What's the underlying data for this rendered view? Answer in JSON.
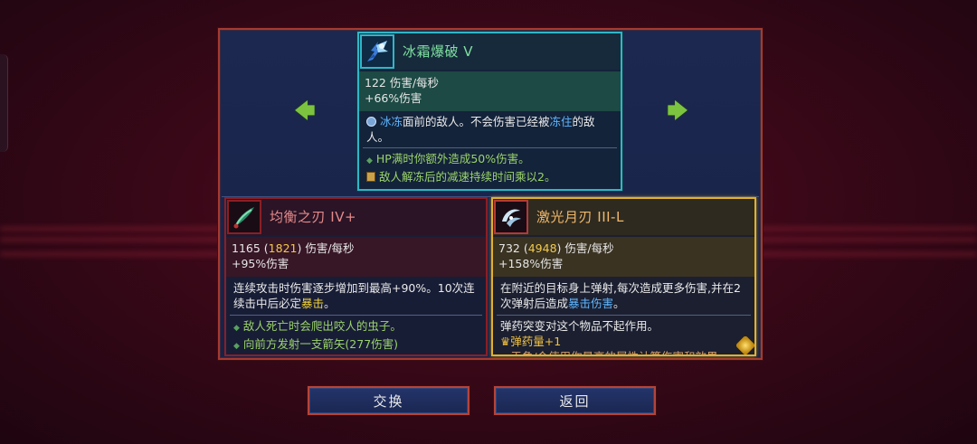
{
  "colors": {
    "uncommon_card_border": "#2fb6c8",
    "epic_card_border": "#8a1f26",
    "legendary_card_border": "#e0b030",
    "button_border": "#b4443a",
    "highlight_blue": "#5fb6ff",
    "highlight_gold": "#f0d23a",
    "perk_green": "#9bd36a"
  },
  "top_item": {
    "icon": "ice-blast-icon",
    "name": "冰霜爆破 V",
    "dps_line": "122 伤害/每秒",
    "bonus_line": "+66%伤害",
    "desc_prefix": "冰冻",
    "desc_mid": "面前的敌人。不会伤害已经被",
    "desc_kw2": "冻住",
    "desc_suffix": "的敌人。",
    "perks": [
      "HP满时你额外造成50%伤害。",
      "敌人解冻后的减速持续时间乘以2。"
    ]
  },
  "left_item": {
    "icon": "balanced-blade-icon",
    "name": "均衡之刃 IV+",
    "dps_base": "1165",
    "dps_boost": "1821",
    "dps_suffix": "伤害/每秒",
    "bonus_line": "+95%伤害",
    "desc_main": "连续攻击时伤害逐步增加到最高+90%。10次连续击中后必定",
    "desc_kw": "暴击",
    "desc_end": "。",
    "perks": [
      "敌人死亡时会爬出咬人的虫子。",
      "向前方发射一支箭矢(277伤害)"
    ]
  },
  "right_item": {
    "icon": "laser-glaive-icon",
    "name": "激光月刃 III-L",
    "dps_base": "732",
    "dps_boost": "4948",
    "dps_suffix": "伤害/每秒",
    "bonus_line": "+158%伤害",
    "desc_main": "在附近的目标身上弹射,每次造成更多伤害,并在2次弹射后造成",
    "desc_kw": "暴击伤害",
    "desc_end": "。",
    "note": "弹药突变对这个物品不起作用。",
    "legendary_affix": "弹药量+1",
    "cut_line": "• 于角/会使用你最高的属性计算伤害和效果"
  },
  "nav": {
    "left_arrow": "🡄",
    "right_arrow": "🡆"
  },
  "buttons": {
    "swap": "交换",
    "back": "返回"
  }
}
